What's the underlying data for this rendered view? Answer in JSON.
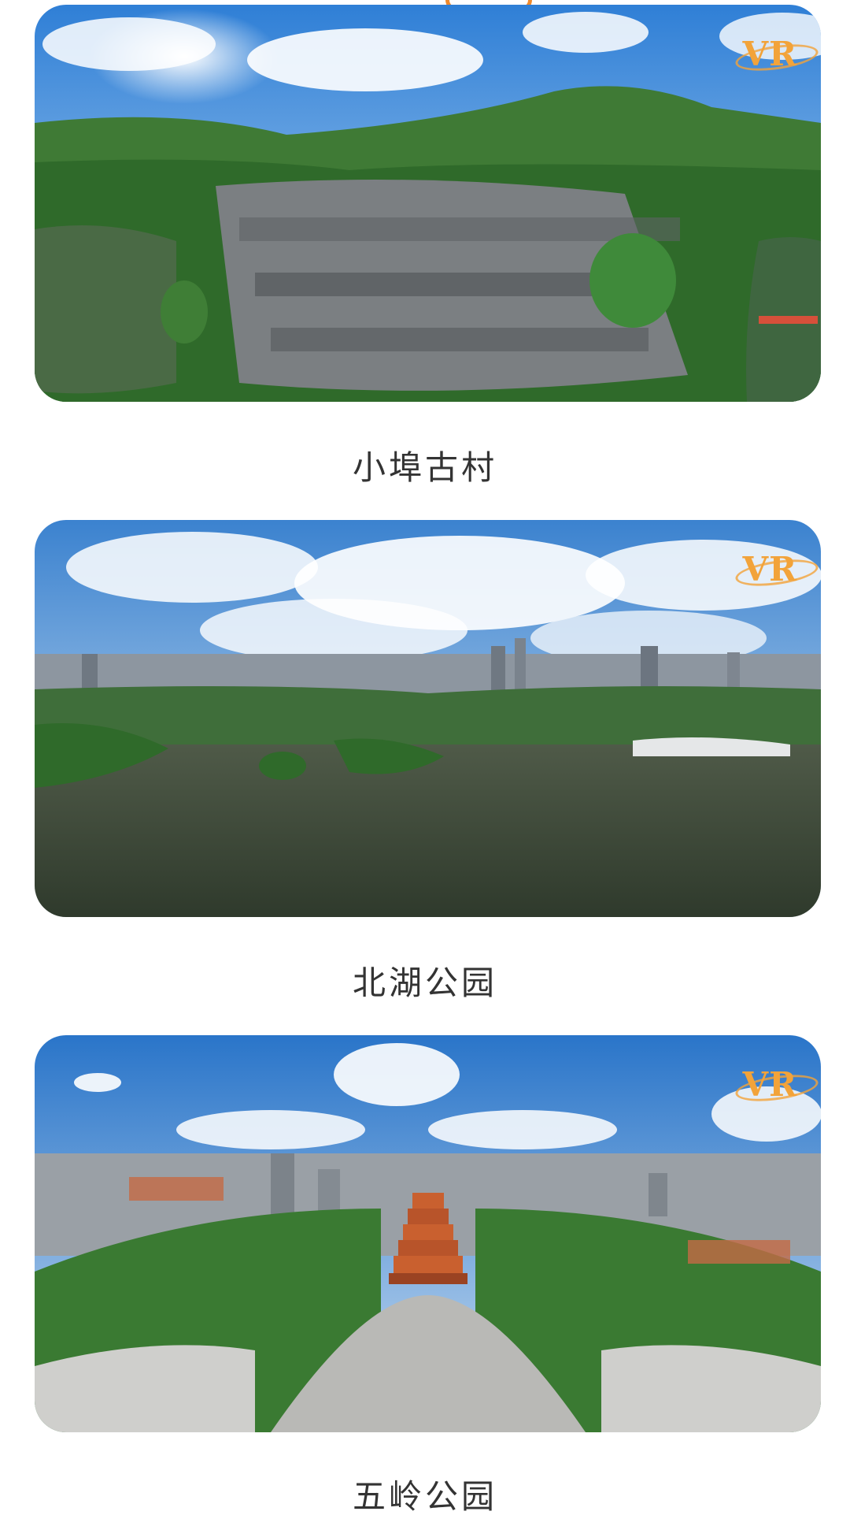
{
  "badge_text": "VR",
  "places": [
    {
      "caption": "小埠古村"
    },
    {
      "caption": "北湖公园"
    },
    {
      "caption": "五岭公园"
    }
  ]
}
